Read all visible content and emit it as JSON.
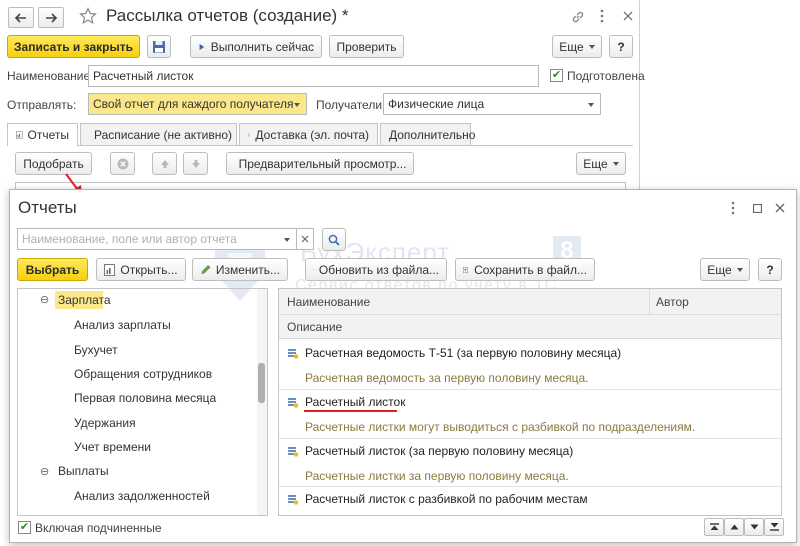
{
  "window": {
    "title": "Рассылка отчетов (создание) *"
  },
  "toolbar": {
    "save_close": "Записать и закрыть",
    "run_now": "Выполнить сейчас",
    "check": "Проверить",
    "more": "Еще",
    "help": "?"
  },
  "form": {
    "name_label": "Наименование:",
    "name_value": "Расчетный листок",
    "prepared_label": "Подготовлена",
    "send_label": "Отправлять:",
    "send_value": "Свой отчет для каждого получателя",
    "recipients_label": "Получатели:",
    "recipients_value": "Физические лица"
  },
  "tabs": [
    {
      "label": "Отчеты"
    },
    {
      "label": "Расписание (не активно)"
    },
    {
      "label": "Доставка (эл. почта)"
    },
    {
      "label": "Дополнительно"
    }
  ],
  "tab_toolbar": {
    "pick": "Подобрать",
    "preview": "Предварительный просмотр...",
    "more": "Еще"
  },
  "dialog": {
    "title": "Отчеты",
    "search_placeholder": "Наименование, поле или автор отчета",
    "select": "Выбрать",
    "open": "Открыть...",
    "edit": "Изменить...",
    "update_from_file": "Обновить из файла...",
    "save_to_file": "Сохранить в файл...",
    "more": "Еще",
    "help": "?",
    "include_subordinates": "Включая подчиненные",
    "tree": [
      {
        "label": "Зарплата",
        "level": 0,
        "group": true,
        "selected": true
      },
      {
        "label": "Анализ зарплаты",
        "level": 1
      },
      {
        "label": "Бухучет",
        "level": 1
      },
      {
        "label": "Обращения сотрудников",
        "level": 1
      },
      {
        "label": "Первая половина месяца",
        "level": 1
      },
      {
        "label": "Удержания",
        "level": 1
      },
      {
        "label": "Учет времени",
        "level": 1
      },
      {
        "label": "Выплаты",
        "level": 0,
        "group": true
      },
      {
        "label": "Анализ задолженностей",
        "level": 1
      }
    ],
    "columns": {
      "name": "Наименование",
      "author": "Автор",
      "description": "Описание"
    },
    "reports": [
      {
        "title": "Расчетная ведомость Т-51 (за первую половину месяца)",
        "description": "Расчетная ведомость за первую половину месяца."
      },
      {
        "title": "Расчетный листок",
        "description": "Расчетные листки могут выводиться с разбивкой по подразделениям.",
        "highlighted": true
      },
      {
        "title": "Расчетный листок (за первую половину месяца)",
        "description": "Расчетные листки за первую половину месяца."
      },
      {
        "title": "Расчетный листок с разбивкой по рабочим местам",
        "description": ""
      }
    ]
  },
  "watermark": {
    "brand": "БухЭксперт",
    "brand_number": "8",
    "tagline": "Сервис ответов по учету в 1С"
  },
  "colors": {
    "accent_yellow": "#f5cf10",
    "selection_yellow": "#fbe88a",
    "annotation_red": "#e02020",
    "description_text": "#8a7a40"
  },
  "icons": {
    "back": "arrow-left-icon",
    "forward": "arrow-right-icon",
    "favorite": "star-icon",
    "link": "link-icon",
    "menu": "vertical-dots-icon",
    "close": "close-icon",
    "save": "floppy-disk-icon",
    "run": "play-icon",
    "report": "report-icon"
  }
}
